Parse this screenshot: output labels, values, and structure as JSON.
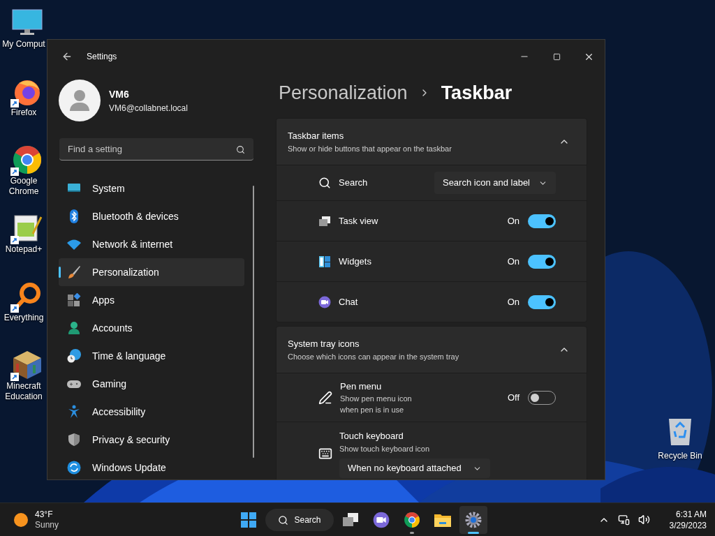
{
  "desktop_icons": [
    {
      "kind": "computer",
      "label": "My Comput",
      "shortcut": false
    },
    {
      "kind": "firefox",
      "label": "Firefox",
      "shortcut": true
    },
    {
      "kind": "chrome",
      "label": "Google Chrome",
      "shortcut": true
    },
    {
      "kind": "notepad",
      "label": "Notepad+",
      "shortcut": true
    },
    {
      "kind": "everything",
      "label": "Everything",
      "shortcut": true
    },
    {
      "kind": "minecraft",
      "label": "Minecraft Education",
      "shortcut": true
    }
  ],
  "recycle_bin": {
    "label": "Recycle Bin"
  },
  "window": {
    "title": "Settings"
  },
  "profile": {
    "name": "VM6",
    "email": "VM6@collabnet.local"
  },
  "search": {
    "placeholder": "Find a setting"
  },
  "nav": [
    {
      "kind": "system",
      "label": "System",
      "selected": false
    },
    {
      "kind": "bluetooth",
      "label": "Bluetooth & devices",
      "selected": false
    },
    {
      "kind": "network",
      "label": "Network & internet",
      "selected": false
    },
    {
      "kind": "personalization",
      "label": "Personalization",
      "selected": true
    },
    {
      "kind": "apps",
      "label": "Apps",
      "selected": false
    },
    {
      "kind": "accounts",
      "label": "Accounts",
      "selected": false
    },
    {
      "kind": "time",
      "label": "Time & language",
      "selected": false
    },
    {
      "kind": "gaming",
      "label": "Gaming",
      "selected": false
    },
    {
      "kind": "accessibility",
      "label": "Accessibility",
      "selected": false
    },
    {
      "kind": "privacy",
      "label": "Privacy & security",
      "selected": false
    },
    {
      "kind": "update",
      "label": "Windows Update",
      "selected": false
    }
  ],
  "breadcrumb": {
    "parent": "Personalization",
    "current": "Taskbar"
  },
  "sections": [
    {
      "title": "Taskbar items",
      "subtitle": "Show or hide buttons that appear on the taskbar",
      "expanded": true,
      "rows": [
        {
          "kind": "dropdown",
          "label": "Search",
          "value": "Search icon and label"
        },
        {
          "kind": "toggle",
          "label": "Task view",
          "state_text": "On",
          "on": true
        },
        {
          "kind": "toggle",
          "label": "Widgets",
          "state_text": "On",
          "on": true
        },
        {
          "kind": "toggle",
          "label": "Chat",
          "state_text": "On",
          "on": true
        }
      ]
    },
    {
      "title": "System tray icons",
      "subtitle": "Choose which icons can appear in the system tray",
      "expanded": true,
      "rows": [
        {
          "kind": "toggle",
          "label": "Pen menu",
          "description": "Show pen menu icon when pen is in use",
          "state_text": "Off",
          "on": false
        },
        {
          "kind": "dropdown_below",
          "label": "Touch keyboard",
          "description": "Show touch keyboard icon",
          "value": "When no keyboard attached"
        }
      ]
    }
  ],
  "taskbar": {
    "weather": {
      "temp": "43°F",
      "condition": "Sunny"
    },
    "search_label": "Search",
    "apps": [
      {
        "kind": "taskview",
        "active": false,
        "running": false
      },
      {
        "kind": "chat",
        "active": false,
        "running": false
      },
      {
        "kind": "chrome",
        "active": false,
        "running": true
      },
      {
        "kind": "explorer",
        "active": false,
        "running": false
      },
      {
        "kind": "settings",
        "active": true,
        "running": true
      }
    ],
    "clock": {
      "time": "6:31 AM",
      "date": "3/29/2023"
    }
  }
}
